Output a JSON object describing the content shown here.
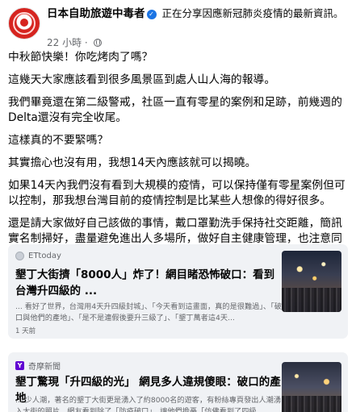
{
  "header": {
    "page_name": "日本自助旅遊中毒者",
    "activity": " 正在分享因應新冠肺炎疫情的最新資訊。",
    "time": "22 小時 · "
  },
  "post": {
    "paragraphs": [
      "中秋節快樂！你吃烤肉了嗎？",
      "這幾天大家應該看到很多風景區到處人山人海的報導。",
      "我們畢竟還在第二級警戒，社區一直有零星的案例和足跡，前幾週的Delta還沒有完全收尾。",
      "這樣真的不要緊嗎？",
      "其實擔心也沒有用，我想14天內應該就可以揭曉。",
      "如果14天內我們沒有看到大規模的疫情，可以保持僅有零星案例但可以控制，那我想台灣目前的疫情控制是比某些人想像的得好很多。",
      "還是請大家做好自己該做的事情，戴口罩勤洗手保持社交距離，簡訊實名制掃好，盡量避免進出人多場所，做好自主健康管理，也注意同住家人和親朋好友的健康。"
    ]
  },
  "cards": [
    {
      "source": "ETtoday",
      "title": "墾丁大街擠「8000人」炸了！網目睹恐怖破口：看到台灣升四級的 ...",
      "snippet": "... 看好了世界，台灣用4天升四級封城」、「今天看到這畫面，真的是很難過」、「破口與他們的產地」、「是不是連假後要升三級了」、「墾丁萬者這4天...",
      "time": "1 天前"
    },
    {
      "source": "奇摩新聞",
      "title": "墾丁驚現「升四級的光」 網見多人違規傻眼：破口的產地",
      "snippet": "... 少人潮，著名的墾丁大街更是湧入了約8000名的遊客，有粉絲專頁發出人潮湧入大街的照片，網友看到除了「防疫破口」，讓他們擔憂「仿佛看到了四級"
    }
  ]
}
